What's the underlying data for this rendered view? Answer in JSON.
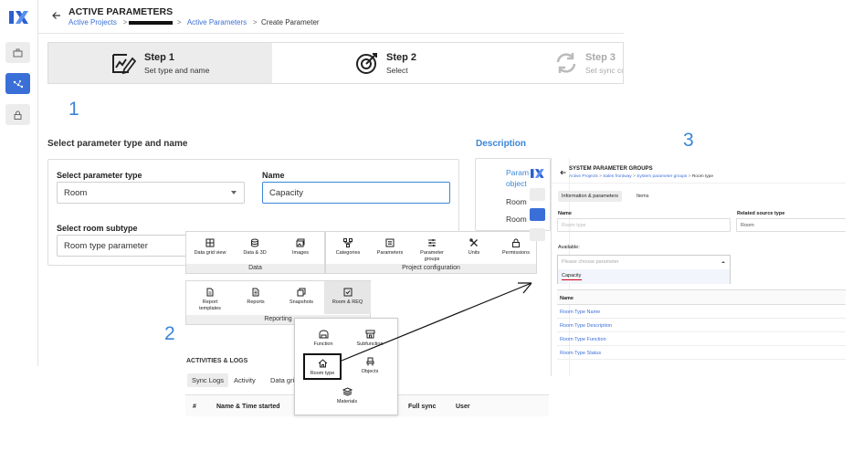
{
  "header": {
    "title": "ACTIVE PARAMETERS",
    "breadcrumbs": [
      "Active Projects",
      "Active Parameters",
      "Create Parameter"
    ]
  },
  "stepper": {
    "steps": [
      {
        "title": "Step 1",
        "subtitle": "Set type and name"
      },
      {
        "title": "Step 2",
        "subtitle": "Select"
      },
      {
        "title": "Step 3",
        "subtitle": "Set sync co"
      }
    ]
  },
  "annotations": {
    "n1": "1",
    "n2": "2",
    "n3": "3"
  },
  "form": {
    "section_title": "Select parameter type and name",
    "type_label": "Select parameter type",
    "type_value": "Room",
    "name_label": "Name",
    "name_value": "Capacity",
    "subtype_label": "Select room subtype",
    "subtype_value": "Room type parameter"
  },
  "description": {
    "title": "Description",
    "lines": [
      "Param",
      "object",
      "Room",
      "Room"
    ]
  },
  "menu": {
    "data_group": {
      "label": "Data",
      "items": [
        "Data grid view",
        "Data & 3D",
        "Images"
      ]
    },
    "project_group": {
      "label": "Project configuration",
      "items": [
        "Categories",
        "Parameters",
        "Parameter groups",
        "Units",
        "Permissions"
      ]
    },
    "reporting_group": {
      "label": "Reporting",
      "items": [
        "Report templates",
        "Reports",
        "Snapshots",
        "Room & REQ"
      ]
    },
    "submenu_items": [
      "Function",
      "Subfunction",
      "Room type",
      "Objects",
      "Materials"
    ]
  },
  "activities": {
    "title": "ACTIVITIES & LOGS",
    "tabs": [
      "Sync Logs",
      "Activity",
      "Data grid"
    ],
    "columns": [
      "#",
      "Name & Time started",
      "Full sync",
      "User"
    ]
  },
  "screen3": {
    "title": "SYSTEM PARAMETER GROUPS",
    "breadcrumbs": [
      "Active Projects",
      "Sales frontway",
      "System parameter groups",
      "Room type"
    ],
    "tabs": [
      "Information & parameters",
      "Items"
    ],
    "name_label": "Name",
    "name_placeholder": "Room type",
    "related_label": "Related source type",
    "related_value": "Room",
    "available_label": "Available:",
    "choose_placeholder": "Please choose parameter",
    "option": "Capacity",
    "table_header": "Name",
    "rows": [
      "Room Type Name",
      "Room Type Description",
      "Room Type Function",
      "Room Type Status"
    ]
  },
  "colors": {
    "accent": "#3b6fd8",
    "annotation": "#3b86d8",
    "highlight": "#111111",
    "underline": "#d0021b"
  }
}
